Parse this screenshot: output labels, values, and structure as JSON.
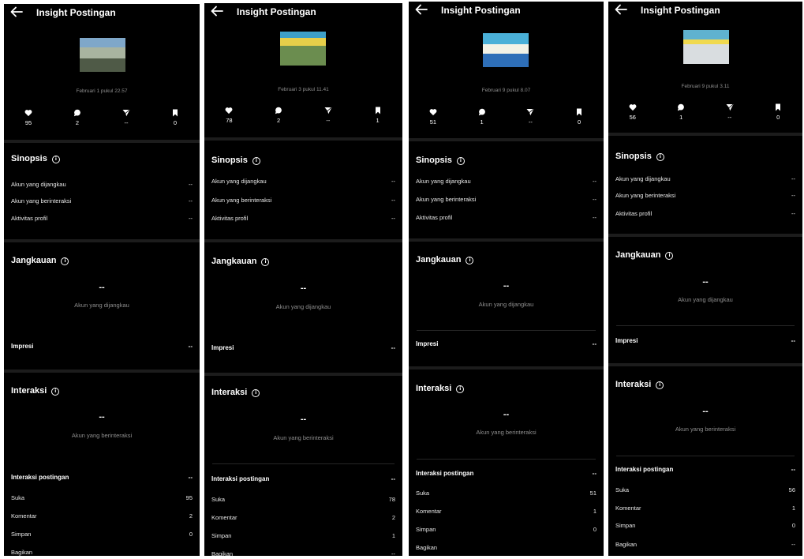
{
  "panels": [
    {
      "header": {
        "title": "Insight Postingan"
      },
      "date": "Februari 1 pukul 22.57",
      "stats": {
        "likes": "95",
        "comments": "2",
        "shares": "--",
        "saves": "0"
      },
      "synopsis": {
        "title": "Sinopsis",
        "rows": [
          {
            "label": "Akun yang dijangkau",
            "value": "--"
          },
          {
            "label": "Akun yang berinteraksi",
            "value": "--"
          },
          {
            "label": "Aktivitas profil",
            "value": "--"
          }
        ]
      },
      "reach": {
        "title": "Jangkauan",
        "value": "--",
        "caption": "Akun yang dijangkau",
        "impressions_label": "Impresi",
        "impressions_value": "--"
      },
      "interaction": {
        "title": "Interaksi",
        "value": "--",
        "caption": "Akun yang berinteraksi",
        "post_label": "Interaksi postingan",
        "post_value": "--",
        "rows": [
          {
            "label": "Suka",
            "value": "95"
          },
          {
            "label": "Komentar",
            "value": "2"
          },
          {
            "label": "Simpan",
            "value": "0"
          },
          {
            "label": "Bagikan",
            "value": ""
          }
        ]
      }
    },
    {
      "header": {
        "title": "Insight Postingan"
      },
      "date": "Februari 3 pukul 11.41",
      "stats": {
        "likes": "78",
        "comments": "2",
        "shares": "--",
        "saves": "1"
      },
      "synopsis": {
        "title": "Sinopsis",
        "rows": [
          {
            "label": "Akun yang dijangkau",
            "value": "--"
          },
          {
            "label": "Akun yang berinteraksi",
            "value": "--"
          },
          {
            "label": "Aktivitas profil",
            "value": "--"
          }
        ]
      },
      "reach": {
        "title": "Jangkauan",
        "value": "--",
        "caption": "Akun yang dijangkau",
        "impressions_label": "Impresi",
        "impressions_value": "--"
      },
      "interaction": {
        "title": "Interaksi",
        "value": "--",
        "caption": "Akun yang berinteraksi",
        "post_label": "Interaksi postingan",
        "post_value": "--",
        "rows": [
          {
            "label": "Suka",
            "value": "78"
          },
          {
            "label": "Komentar",
            "value": "2"
          },
          {
            "label": "Simpan",
            "value": "1"
          },
          {
            "label": "Bagikan",
            "value": "--"
          }
        ]
      }
    },
    {
      "header": {
        "title": "Insight Postingan"
      },
      "date": "Februari 9 pukul 8.07",
      "stats": {
        "likes": "51",
        "comments": "1",
        "shares": "--",
        "saves": "0"
      },
      "synopsis": {
        "title": "Sinopsis",
        "rows": [
          {
            "label": "Akun yang dijangkau",
            "value": "--"
          },
          {
            "label": "Akun yang berinteraksi",
            "value": "--"
          },
          {
            "label": "Aktivitas profil",
            "value": "--"
          }
        ]
      },
      "reach": {
        "title": "Jangkauan",
        "value": "--",
        "caption": "Akun yang dijangkau",
        "impressions_label": "Impresi",
        "impressions_value": "--"
      },
      "interaction": {
        "title": "Interaksi",
        "value": "--",
        "caption": "Akun yang berinteraksi",
        "post_label": "Interaksi postingan",
        "post_value": "--",
        "rows": [
          {
            "label": "Suka",
            "value": "51"
          },
          {
            "label": "Komentar",
            "value": "1"
          },
          {
            "label": "Simpan",
            "value": "0"
          },
          {
            "label": "Bagikan",
            "value": ""
          }
        ]
      }
    },
    {
      "header": {
        "title": "Insight Postingan"
      },
      "date": "Februari 9 pukul 3.11",
      "stats": {
        "likes": "56",
        "comments": "1",
        "shares": "--",
        "saves": "0"
      },
      "synopsis": {
        "title": "Sinopsis",
        "rows": [
          {
            "label": "Akun yang dijangkau",
            "value": "--"
          },
          {
            "label": "Akun yang berinteraksi",
            "value": "--"
          },
          {
            "label": "Aktivitas profil",
            "value": "--"
          }
        ]
      },
      "reach": {
        "title": "Jangkauan",
        "value": "--",
        "caption": "Akun yang dijangkau",
        "impressions_label": "Impresi",
        "impressions_value": "--"
      },
      "interaction": {
        "title": "Interaksi",
        "value": "--",
        "caption": "Akun yang berinteraksi",
        "post_label": "Interaksi postingan",
        "post_value": "--",
        "rows": [
          {
            "label": "Suka",
            "value": "56"
          },
          {
            "label": "Komentar",
            "value": "1"
          },
          {
            "label": "Simpan",
            "value": "0"
          },
          {
            "label": "Bagikan",
            "value": "--"
          }
        ]
      }
    }
  ],
  "icons": {
    "back": "arrow-left-icon",
    "likes": "heart-icon",
    "comments": "comment-bubble-icon",
    "shares": "send-icon",
    "saves": "bookmark-icon",
    "info": "info-icon"
  },
  "colors": {
    "background": "#000000",
    "separator": "#1c1c1c",
    "muted_text": "#8e8e8e",
    "text": "#ffffff"
  }
}
